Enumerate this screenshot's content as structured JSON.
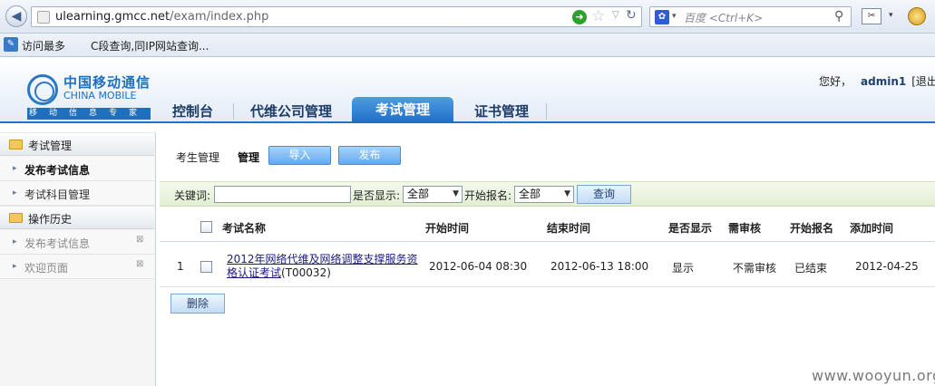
{
  "browser": {
    "url_host": "ulearning.gmcc.net",
    "url_path": "/exam/index.php",
    "search_engine_icon": "baidu-paw-icon",
    "search_placeholder": "百度 <Ctrl+K>",
    "bookmarks": [
      "访问最多",
      "C段查询,同IP网站查询..."
    ]
  },
  "header": {
    "logo_cn": "中国移动通信",
    "logo_en": "CHINA MOBILE",
    "logo_slogan": "移动信息专家",
    "greeting": "您好，",
    "username": "admin1",
    "logout": "[退出]",
    "tabs": [
      "控制台",
      "代维公司管理",
      "考试管理",
      "证书管理"
    ],
    "active_tab": "考试管理"
  },
  "sidebar": {
    "groups": [
      {
        "label": "考试管理",
        "items": [
          {
            "label": "发布考试信息"
          },
          {
            "label": "考试科目管理"
          }
        ]
      },
      {
        "label": "操作历史",
        "items": [
          {
            "label": "发布考试信息"
          },
          {
            "label": "欢迎页面"
          }
        ]
      }
    ]
  },
  "main": {
    "toolbar": {
      "label1": "考生管理",
      "label2": "管理",
      "import_btn": "导入",
      "publish_btn": "发布"
    },
    "filter": {
      "keyword_label": "关键词:",
      "keyword_value": "",
      "show_label": "是否显示:",
      "show_value": "全部",
      "signup_label": "开始报名:",
      "signup_value": "全部",
      "query_btn": "查询"
    },
    "table": {
      "columns": [
        "考试名称",
        "开始时间",
        "结束时间",
        "是否显示",
        "需审核",
        "开始报名",
        "添加时间"
      ],
      "rows": [
        {
          "index": "1",
          "name": "2012年网络代维及网络调整支撑服务资格认证考试",
          "code": "(T00032)",
          "start": "2012-06-04 08:30",
          "end": "2012-06-13 18:00",
          "show": "显示",
          "review": "不需审核",
          "signup": "已结束",
          "added": "2012-04-25"
        }
      ]
    },
    "delete_btn": "删除"
  },
  "watermark": "www.wooyun.org"
}
